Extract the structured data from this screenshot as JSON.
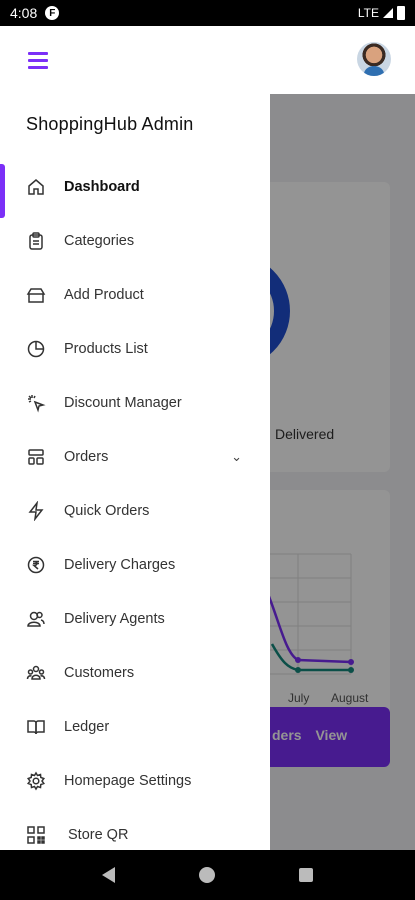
{
  "status_bar": {
    "time": "4:08",
    "app_icon": "F",
    "network": "LTE"
  },
  "app_bar": {
    "menu_icon": "hamburger-icon",
    "avatar": "user-avatar"
  },
  "drawer": {
    "title": "ShoppingHub Admin",
    "items": [
      {
        "label": "Dashboard",
        "icon": "home-icon",
        "active": true
      },
      {
        "label": "Categories",
        "icon": "clipboard-icon"
      },
      {
        "label": "Add Product",
        "icon": "box-icon"
      },
      {
        "label": "Products List",
        "icon": "pie-chart-icon"
      },
      {
        "label": "Discount Manager",
        "icon": "pointer-click-icon"
      },
      {
        "label": "Orders",
        "icon": "orders-icon",
        "expandable": true
      },
      {
        "label": "Quick Orders",
        "icon": "lightning-icon"
      },
      {
        "label": "Delivery Charges",
        "icon": "rupee-icon"
      },
      {
        "label": "Delivery Agents",
        "icon": "users-icon"
      },
      {
        "label": "Customers",
        "icon": "group-icon"
      },
      {
        "label": "Ledger",
        "icon": "book-icon"
      },
      {
        "label": "Homepage Settings",
        "icon": "gear-icon"
      },
      {
        "label": "Store QR",
        "icon": "qr-icon"
      }
    ]
  },
  "background": {
    "donut_label": "Delivered",
    "chart_x_labels": [
      "July",
      "August"
    ],
    "button_text": "ders",
    "button_view": "View"
  },
  "colors": {
    "accent": "#7b2ff7",
    "donut": "#1f4fd1",
    "line_purple": "#7b2ff7",
    "line_teal": "#14897d"
  }
}
